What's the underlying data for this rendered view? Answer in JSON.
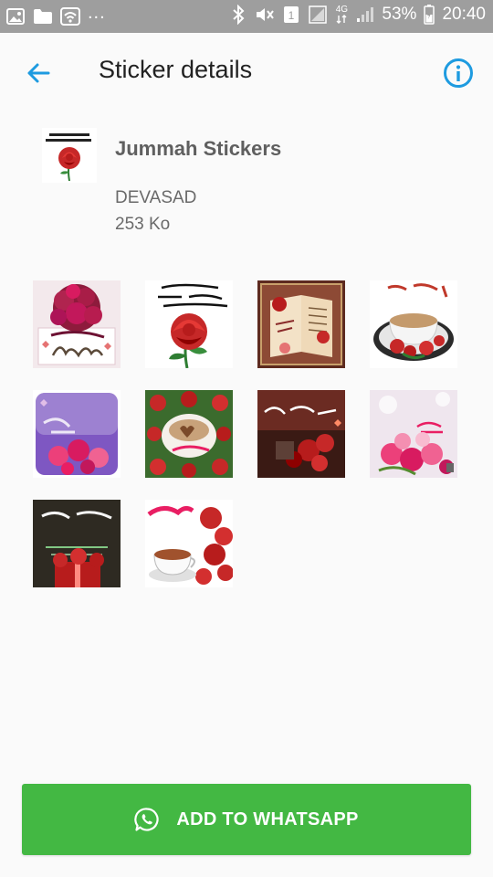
{
  "status_bar": {
    "left_icons": [
      "image-icon",
      "folder-icon",
      "wifi-icon",
      "more-dots-icon"
    ],
    "more_dots": "...",
    "right_icons": [
      "bluetooth-icon",
      "mute-icon",
      "sim-icon",
      "signal-icon",
      "data-4g-icon",
      "signal-bars-icon",
      "battery-icon"
    ],
    "network": "4G",
    "battery": "53%",
    "time": "20:40"
  },
  "app_bar": {
    "title": "Sticker details",
    "back_icon": "arrow-back-icon",
    "info_icon": "info-icon",
    "accent": "#1e9be0"
  },
  "pack": {
    "name": "Jummah Stickers",
    "author": "DEVASAD",
    "size": "253 Ko",
    "icon": "rose-sticker-icon"
  },
  "stickers": [
    {
      "name": "rose-bouquet-sticker",
      "caption": "مساء الورد"
    },
    {
      "name": "red-rose-sticker",
      "caption": "مساء الورد يا أحلى وأرق مخلوق"
    },
    {
      "name": "book-rose-sticker",
      "caption": "صباح الورد"
    },
    {
      "name": "coffee-roses-sticker",
      "caption": "صباح الورد"
    },
    {
      "name": "purple-roses-sticker",
      "caption": "مساء الخير"
    },
    {
      "name": "heart-coffee-sticker",
      "caption": "مساء الخير"
    },
    {
      "name": "dark-roses-sticker",
      "caption": "مساء الورد"
    },
    {
      "name": "pink-roses-sticker",
      "caption": "مساء الخير"
    },
    {
      "name": "gift-roses-sticker",
      "caption": "مساء الورد"
    },
    {
      "name": "tea-roses-sticker",
      "caption": "مساء الورد"
    }
  ],
  "add_button": {
    "label": "ADD TO WHATSAPP",
    "icon": "whatsapp-icon",
    "color": "#43b843"
  }
}
